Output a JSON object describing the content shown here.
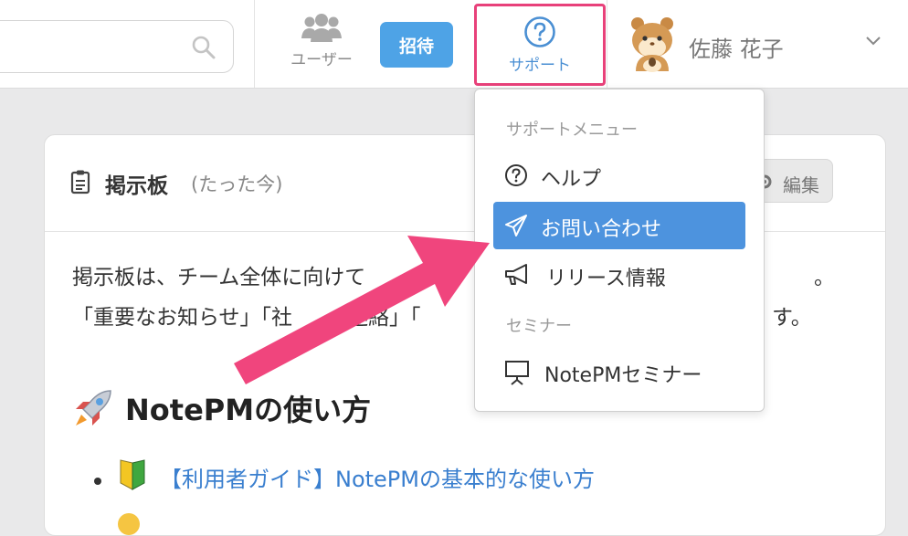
{
  "header": {
    "users_label": "ユーザー",
    "invite_label": "招待",
    "support_label": "サポート",
    "user_name": "佐藤 花子"
  },
  "card": {
    "title": "掲示板",
    "time": "(たった今)",
    "edit_label": "編集",
    "body_line1": "掲示板は、チーム全体に向けて",
    "body_line1_tail": "。",
    "body_line2_a": "「重要なお知らせ」「社",
    "body_line2_b": "連絡」「",
    "body_line2_tail": "す。",
    "section_title": "NotePMの使い方",
    "bullet_link": "【利用者ガイド】NotePMの基本的な使い方"
  },
  "dropdown": {
    "section1": "サポートメニュー",
    "items": [
      {
        "label": "ヘルプ",
        "icon": "question-circle-icon"
      },
      {
        "label": "お問い合わせ",
        "icon": "paper-plane-icon"
      },
      {
        "label": "リリース情報",
        "icon": "megaphone-icon"
      }
    ],
    "section2": "セミナー",
    "seminar_item": {
      "label": "NotePMセミナー",
      "icon": "presentation-icon"
    }
  },
  "colors": {
    "accent": "#4ea3e6",
    "highlight_border": "#e8417a",
    "arrow": "#f0457d",
    "active_item": "#4d93de"
  }
}
